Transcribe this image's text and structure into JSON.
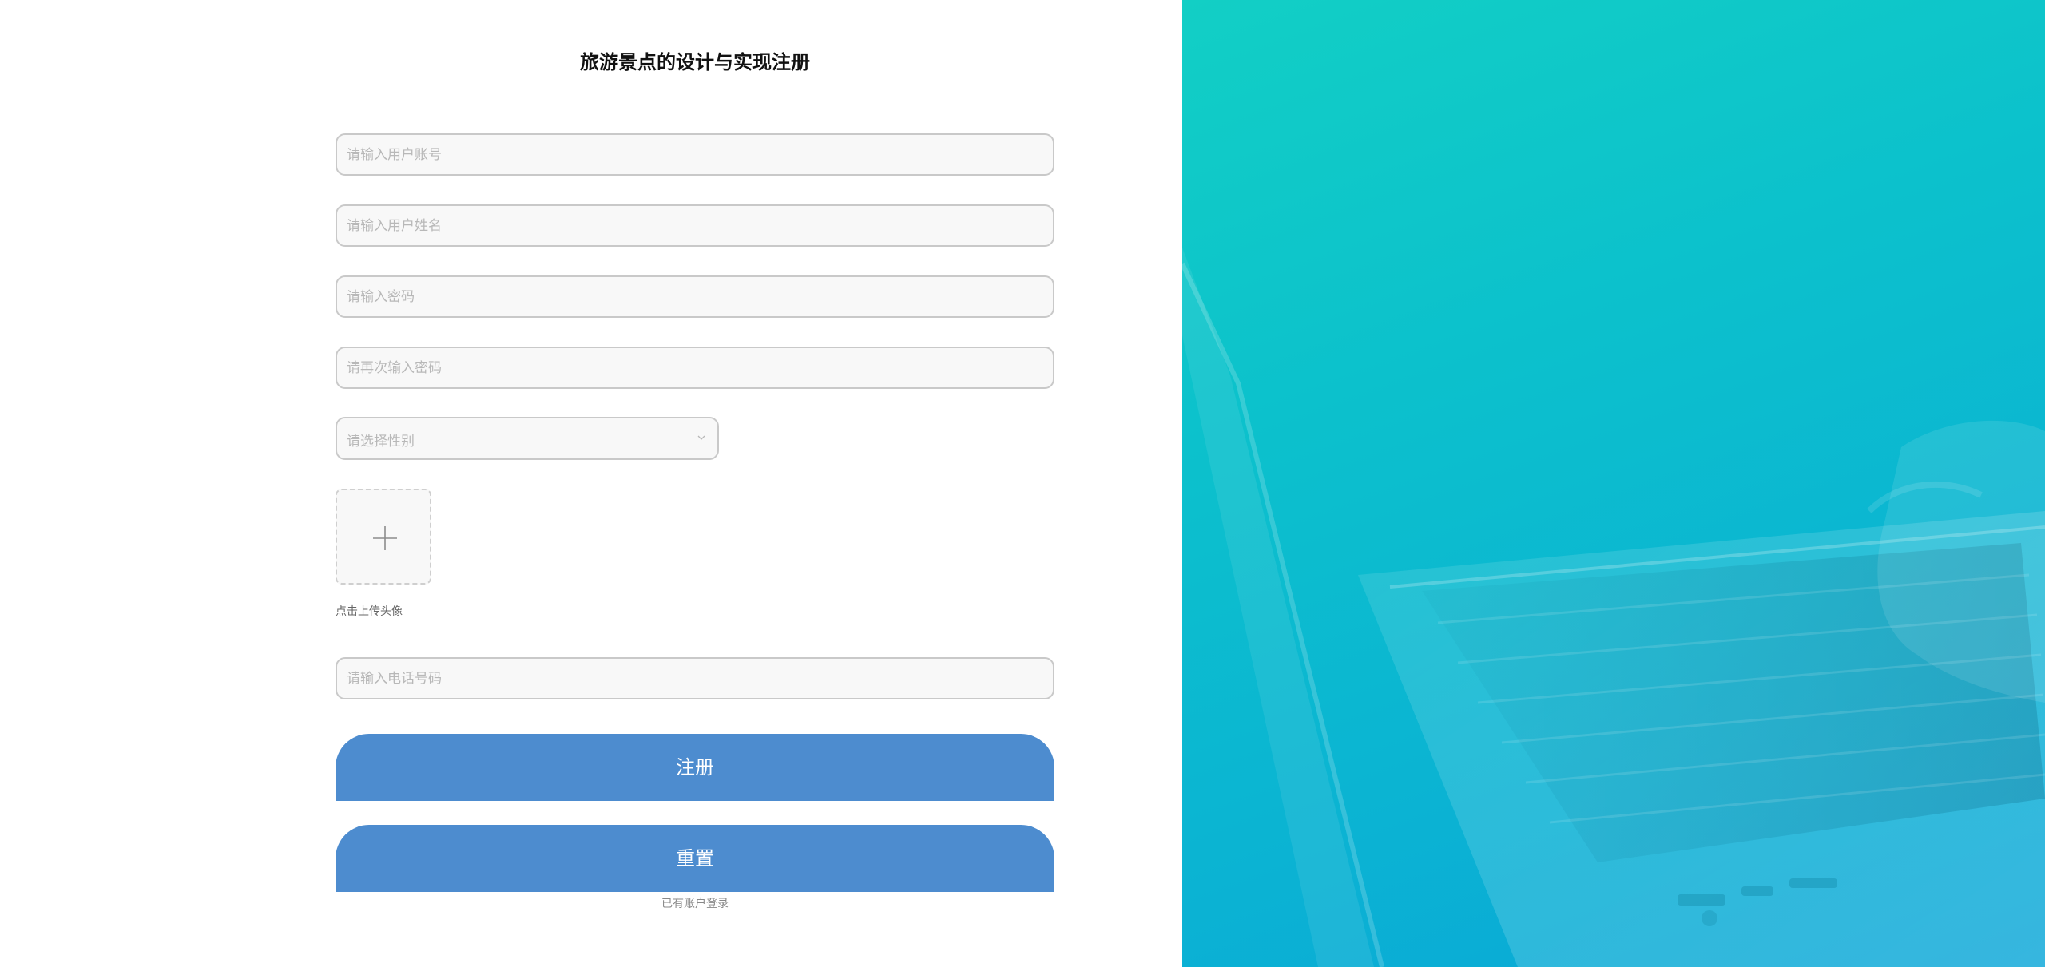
{
  "form": {
    "title": "旅游景点的设计与实现注册",
    "account_placeholder": "请输入用户账号",
    "name_placeholder": "请输入用户姓名",
    "password_placeholder": "请输入密码",
    "confirm_password_placeholder": "请再次输入密码",
    "gender_placeholder": "请选择性别",
    "upload_label": "点击上传头像",
    "phone_placeholder": "请输入电话号码",
    "register_label": "注册",
    "reset_label": "重置",
    "login_link": "已有账户登录"
  },
  "icons": {
    "select_chevron": "chevron-down-icon",
    "upload_plus": "plus-icon"
  },
  "colors": {
    "primary_button": "#4d8ccf",
    "right_panel_top": "#12cfc5",
    "right_panel_bottom": "#0aa6d8"
  }
}
